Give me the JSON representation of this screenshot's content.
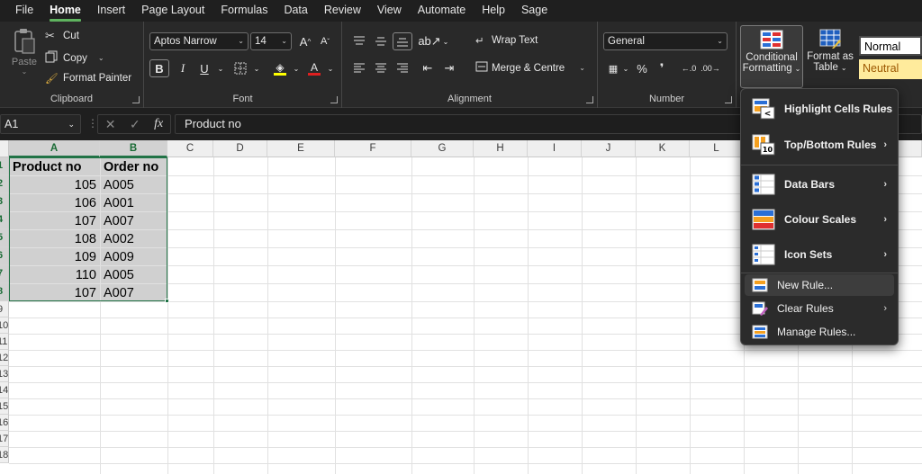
{
  "menubar": {
    "tabs": [
      {
        "label": "File",
        "active": false
      },
      {
        "label": "Home",
        "active": true
      },
      {
        "label": "Insert",
        "active": false
      },
      {
        "label": "Page Layout",
        "active": false
      },
      {
        "label": "Formulas",
        "active": false
      },
      {
        "label": "Data",
        "active": false
      },
      {
        "label": "Review",
        "active": false
      },
      {
        "label": "View",
        "active": false
      },
      {
        "label": "Automate",
        "active": false
      },
      {
        "label": "Help",
        "active": false
      },
      {
        "label": "Sage",
        "active": false
      }
    ]
  },
  "ribbon": {
    "clipboard": {
      "label": "Clipboard",
      "paste": "Paste",
      "cut": "Cut",
      "copy": "Copy",
      "format_painter": "Format Painter"
    },
    "font": {
      "label": "Font",
      "font_name": "Aptos Narrow",
      "font_size": "14",
      "bold": "B",
      "italic": "I",
      "underline": "U"
    },
    "alignment": {
      "label": "Alignment",
      "wrap_text": "Wrap Text",
      "merge_centre": "Merge & Centre"
    },
    "number": {
      "label": "Number",
      "format": "General"
    },
    "styles": {
      "conditional_formatting": [
        "Conditional",
        "Formatting"
      ],
      "format_as_table": [
        "Format as",
        "Table"
      ],
      "normal": "Normal",
      "neutral": "Neutral"
    }
  },
  "formula_bar": {
    "name_box": "A1",
    "fx": "fx",
    "content": "Product no"
  },
  "grid": {
    "columns": [
      "A",
      "B",
      "C",
      "D",
      "E",
      "F",
      "G",
      "H",
      "I",
      "J",
      "K",
      "L"
    ],
    "row_numbers": [
      "1",
      "2",
      "3",
      "4",
      "5",
      "6",
      "7",
      "8",
      "9",
      "10",
      "11",
      "12",
      "13",
      "14",
      "15",
      "16",
      "17",
      "18"
    ],
    "headers": [
      "Product no",
      "Order no"
    ],
    "rows": [
      [
        "105",
        "A005"
      ],
      [
        "106",
        "A001"
      ],
      [
        "107",
        "A007"
      ],
      [
        "108",
        "A002"
      ],
      [
        "109",
        "A009"
      ],
      [
        "110",
        "A005"
      ],
      [
        "107",
        "A007"
      ]
    ]
  },
  "cf_menu": {
    "items": [
      {
        "label": "Highlight Cells Rules",
        "submenu": true
      },
      {
        "label": "Top/Bottom Rules",
        "submenu": true
      },
      {
        "label": "Data Bars",
        "submenu": true
      },
      {
        "label": "Colour Scales",
        "submenu": true
      },
      {
        "label": "Icon Sets",
        "submenu": true
      },
      {
        "label": "New Rule...",
        "submenu": false
      },
      {
        "label": "Clear Rules",
        "submenu": true
      },
      {
        "label": "Manage Rules...",
        "submenu": false
      }
    ],
    "icon_text": {
      "highlight": "<",
      "topbottom": "10"
    }
  },
  "colors": {
    "accent_green": "#217346",
    "tab_underline": "#5fb35f",
    "selection_fill": "#d0d0d0",
    "neutral_fill": "#ffeb9c"
  }
}
